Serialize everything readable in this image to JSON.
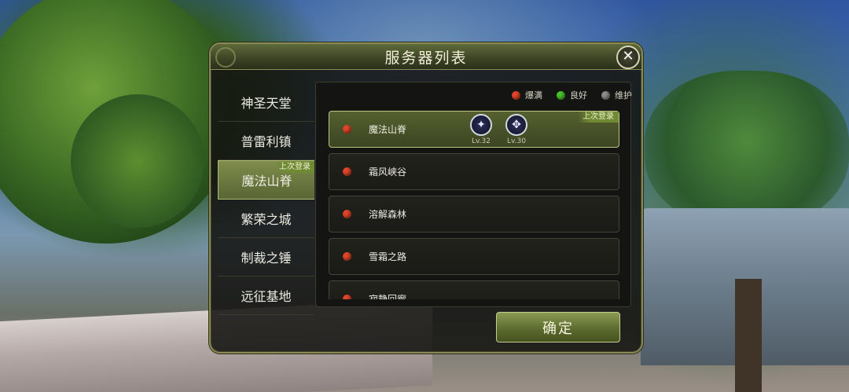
{
  "dialog": {
    "title": "服务器列表",
    "close_glyph": "✕",
    "confirm_label": "确定"
  },
  "legend": [
    {
      "label": "爆满",
      "color": "#e0452a"
    },
    {
      "label": "良好",
      "color": "#48c22c"
    },
    {
      "label": "维护",
      "color": "#8c8c86"
    }
  ],
  "regions": {
    "selected_index": 2,
    "last_login_tag": "上次登录",
    "items": [
      {
        "label": "神圣天堂"
      },
      {
        "label": "普雷利镇"
      },
      {
        "label": "魔法山脊"
      },
      {
        "label": "繁荣之城"
      },
      {
        "label": "制裁之锤"
      },
      {
        "label": "远征基地"
      }
    ]
  },
  "servers": {
    "last_login_tag": "上次登录",
    "items": [
      {
        "name": "魔法山脊",
        "status_color": "#e0452a",
        "selected": true,
        "characters": [
          {
            "icon": "mage-class-icon",
            "glyph": "✦",
            "level": "Lv.32"
          },
          {
            "icon": "priest-class-icon",
            "glyph": "✥",
            "level": "Lv.30"
          }
        ]
      },
      {
        "name": "霜风峡谷",
        "status_color": "#e0452a"
      },
      {
        "name": "溶解森林",
        "status_color": "#e0452a"
      },
      {
        "name": "雪霜之路",
        "status_color": "#e0452a"
      },
      {
        "name": "寂静回廊",
        "status_color": "#e0452a"
      }
    ]
  }
}
